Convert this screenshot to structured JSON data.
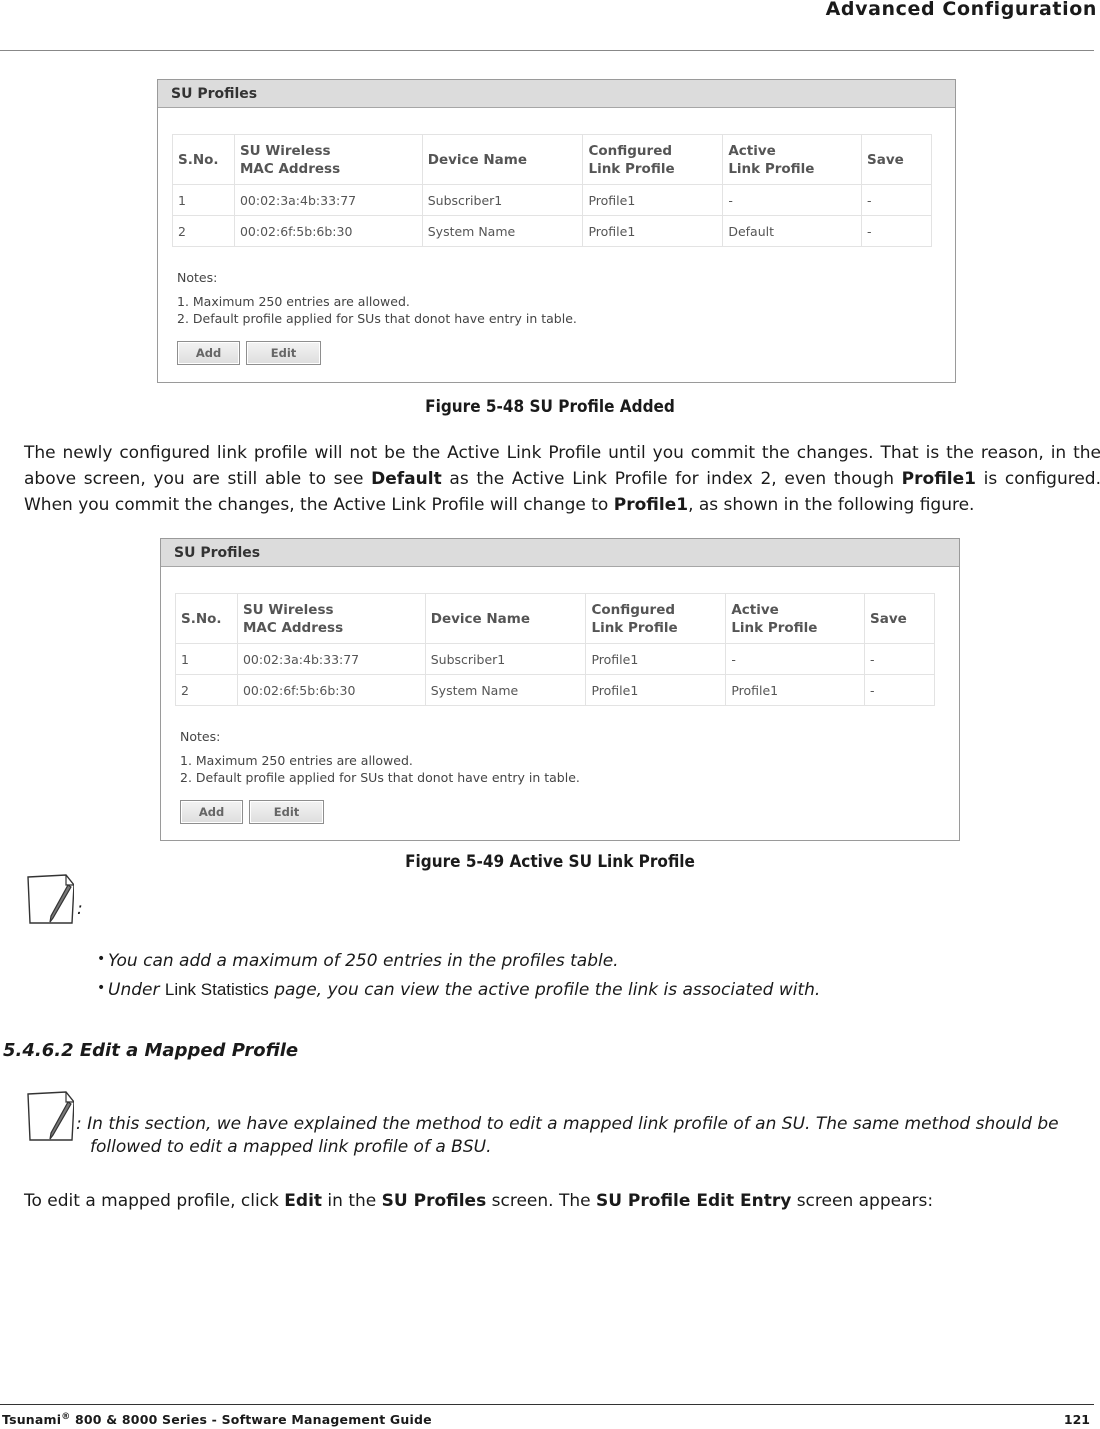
{
  "header": {
    "title": "Advanced Configuration"
  },
  "figures": [
    {
      "panel_title": "SU Profiles",
      "columns": [
        "S.No.",
        "SU Wireless\nMAC Address",
        "Device Name",
        "Configured\nLink Profile",
        "Active\nLink Profile",
        "Save"
      ],
      "rows": [
        [
          "1",
          "00:02:3a:4b:33:77",
          "Subscriber1",
          "Profile1",
          "-",
          "-"
        ],
        [
          "2",
          "00:02:6f:5b:6b:30",
          "System Name",
          "Profile1",
          "Default",
          "-"
        ]
      ],
      "notes_label": "Notes:",
      "notes": [
        "1.  Maximum 250 entries are allowed.",
        "2.  Default profile applied for SUs that donot have entry in table."
      ],
      "buttons": {
        "add": "Add",
        "edit": "Edit"
      },
      "caption": "Figure 5-48 SU Profile Added"
    },
    {
      "panel_title": "SU Profiles",
      "columns": [
        "S.No.",
        "SU Wireless\nMAC Address",
        "Device Name",
        "Configured\nLink Profile",
        "Active\nLink Profile",
        "Save"
      ],
      "rows": [
        [
          "1",
          "00:02:3a:4b:33:77",
          "Subscriber1",
          "Profile1",
          "-",
          "-"
        ],
        [
          "2",
          "00:02:6f:5b:6b:30",
          "System Name",
          "Profile1",
          "Profile1",
          "-"
        ]
      ],
      "notes_label": "Notes:",
      "notes": [
        "1.  Maximum 250 entries are allowed.",
        "2.  Default profile applied for SUs that donot have entry in table."
      ],
      "buttons": {
        "add": "Add",
        "edit": "Edit"
      },
      "caption": "Figure 5-49 Active SU Link Profile"
    }
  ],
  "paragraph1": {
    "t1": "The newly configured link profile will not be the Active Link Profile until you commit the changes. That is the reason, in the above screen, you are still able to see ",
    "b1": "Default",
    "t2": " as the Active Link Profile for index 2, even though ",
    "b2": "Profile1",
    "t3": " is configured. When you commit the changes, the Active Link Profile will change to ",
    "b3": "Profile1",
    "t4": ", as shown in the following figure."
  },
  "note1": {
    "colon": ":",
    "bullets": [
      {
        "text": "You can add a maximum of 250 entries in the profiles table."
      },
      {
        "pre": "Under ",
        "ui": "Link Statistics",
        "post": " page, you can view the active profile the link is associated with."
      }
    ]
  },
  "section": {
    "heading": "5.4.6.2 Edit a Mapped Profile"
  },
  "note2": {
    "line1": ": In this section, we have explained the method to edit a mapped link profile of an SU. The same method should be",
    "line2": "followed to edit a mapped link profile of a BSU."
  },
  "paragraph2": {
    "t1": "To edit a mapped profile, click ",
    "b1": "Edit",
    "t2": " in the ",
    "b2": "SU Profiles",
    "t3": " screen. The ",
    "b3": "SU Profile Edit Entry",
    "t4": " screen appears:"
  },
  "footer": {
    "brand": "Tsunami",
    "reg": "®",
    "rest": " 800 & 8000 Series - Software Management Guide",
    "page": "121"
  }
}
